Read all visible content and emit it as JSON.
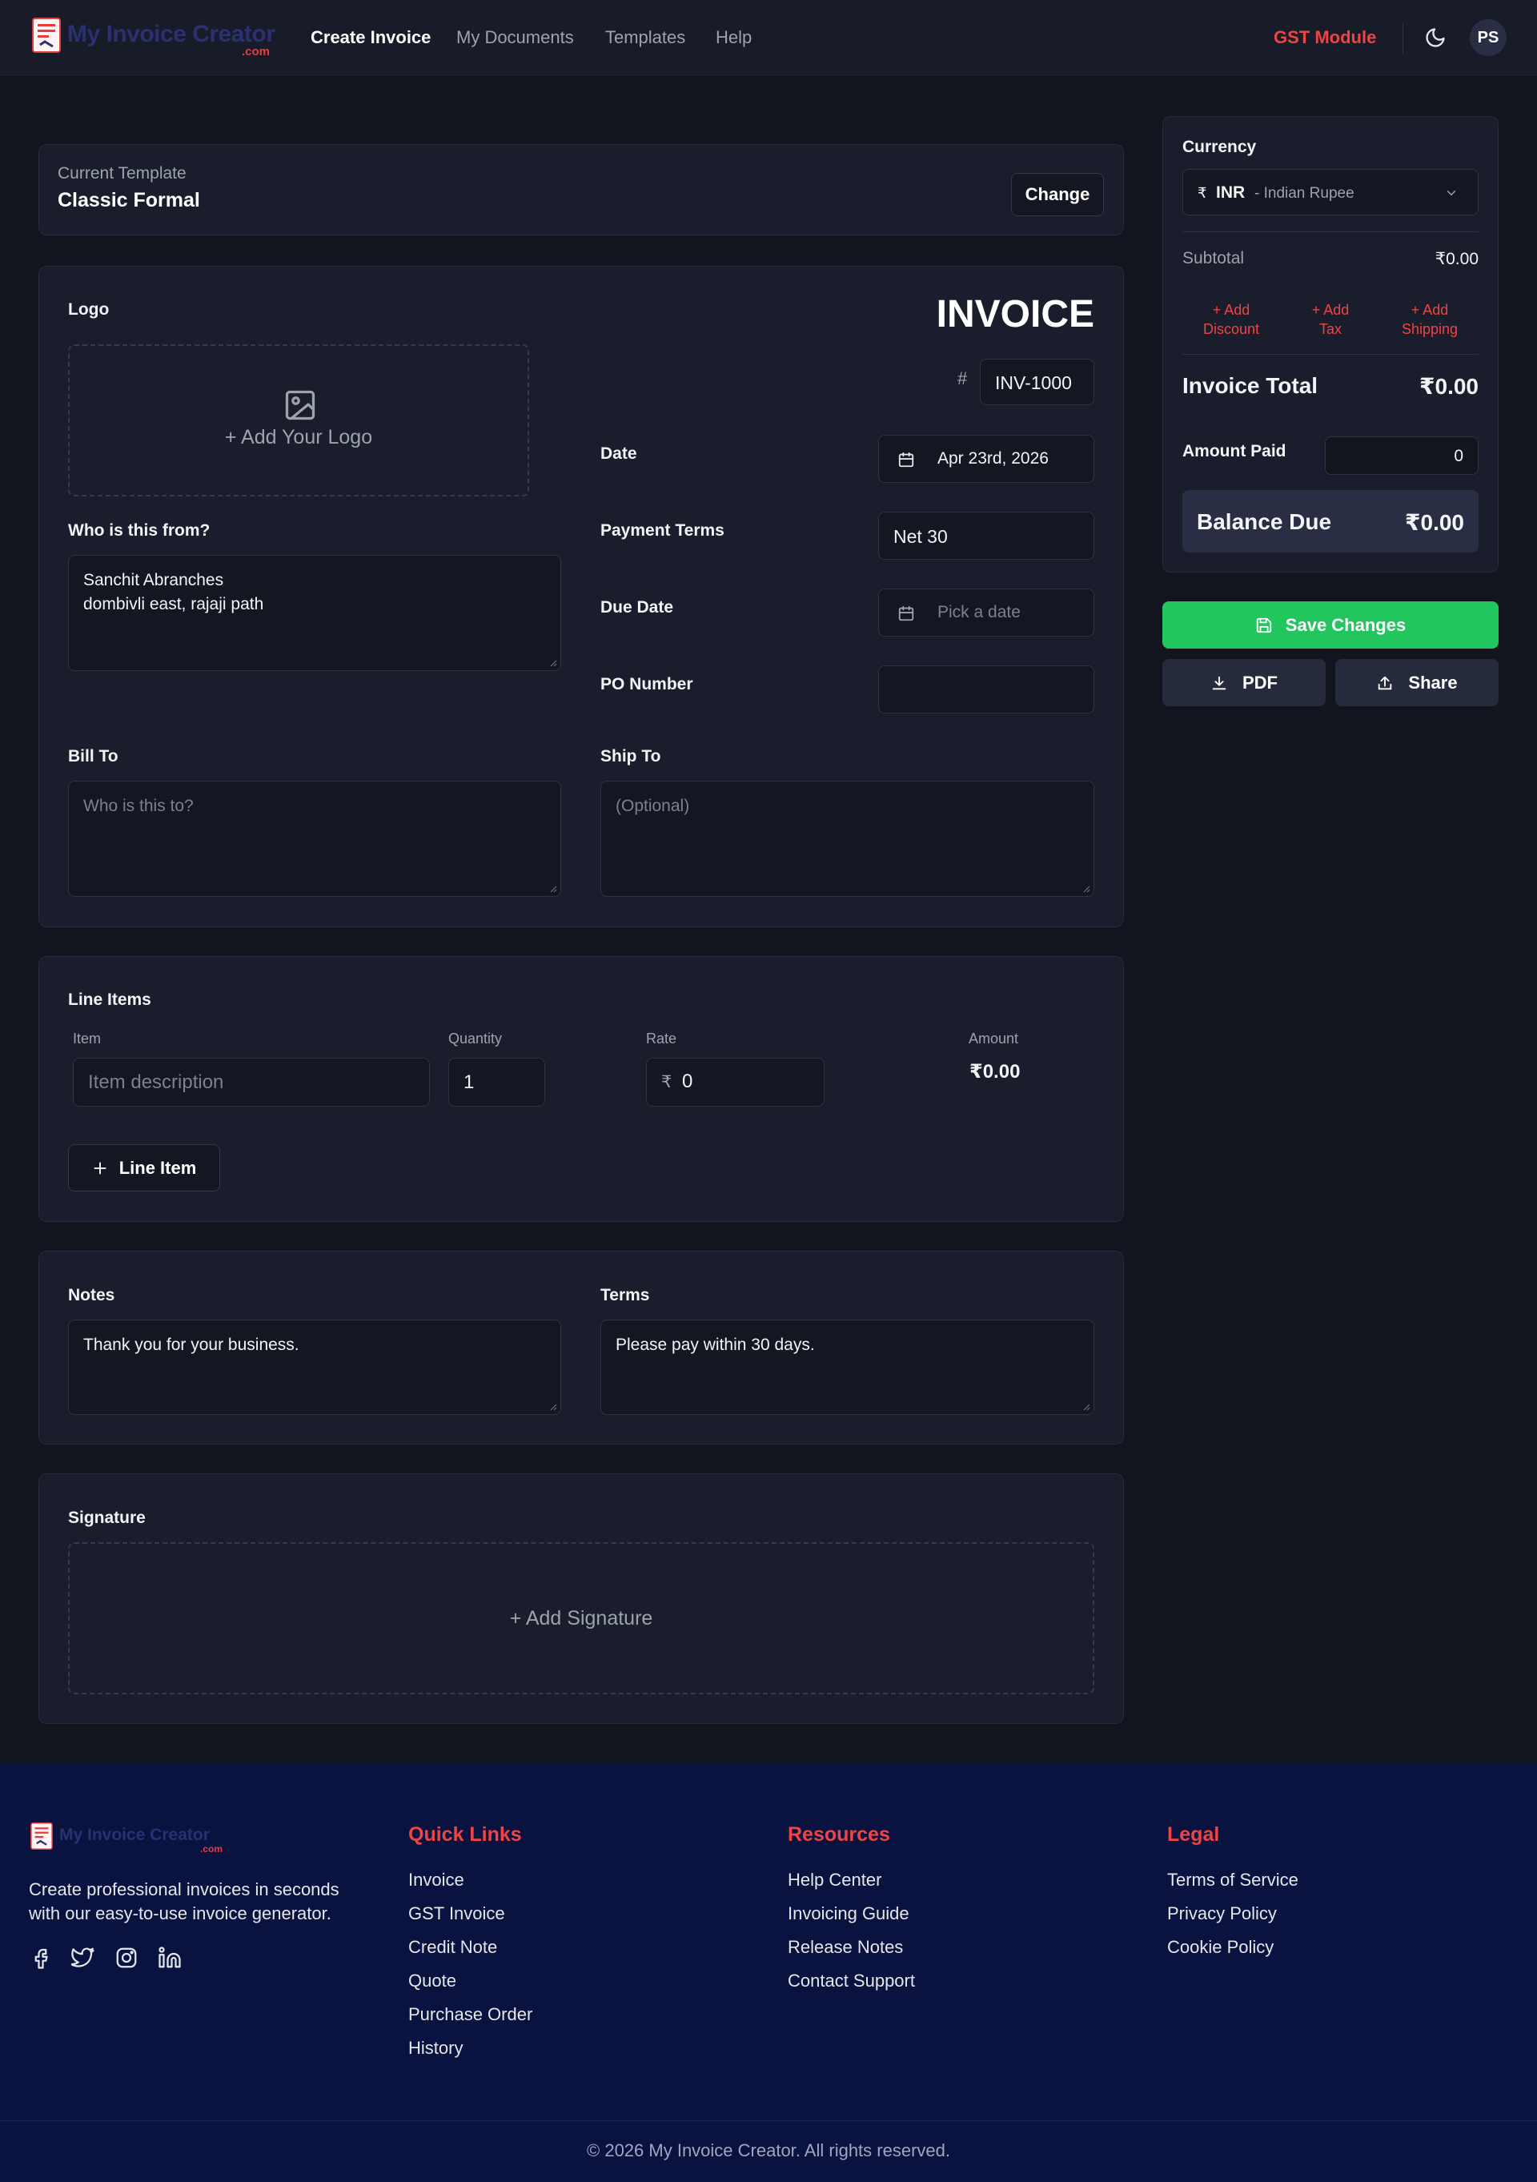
{
  "header": {
    "brand": "My Invoice Creator",
    "brand_suffix": ".com",
    "nav": [
      "Create Invoice",
      "My Documents",
      "Templates",
      "Help"
    ],
    "gst": "GST Module",
    "avatar": "PS"
  },
  "template": {
    "label": "Current Template",
    "name": "Classic Formal",
    "change": "Change"
  },
  "invoice": {
    "logo_label": "Logo",
    "logo_placeholder": "+ Add Your Logo",
    "title": "INVOICE",
    "hash": "#",
    "number": "INV-1000",
    "from_label": "Who is this from?",
    "from_value": "Sanchit Abranches\ndombivli east, rajaji path",
    "date_label": "Date",
    "date_value": "Apr 23rd, 2026",
    "terms_label": "Payment Terms",
    "terms_value": "Net 30",
    "due_label": "Due Date",
    "due_placeholder": "Pick a date",
    "po_label": "PO Number",
    "po_value": "",
    "bill_label": "Bill To",
    "bill_placeholder": "Who is this to?",
    "ship_label": "Ship To",
    "ship_placeholder": "(Optional)"
  },
  "line_items": {
    "title": "Line Items",
    "columns": [
      "Item",
      "Quantity",
      "Rate",
      "Amount"
    ],
    "rows": [
      {
        "item_placeholder": "Item description",
        "quantity": "1",
        "currency": "₹",
        "rate": "0",
        "amount": "₹0.00"
      }
    ],
    "add_label": "Line Item"
  },
  "notes": {
    "notes_label": "Notes",
    "notes_value": "Thank you for your business.",
    "terms_label": "Terms",
    "terms_value": "Please pay within 30 days."
  },
  "signature": {
    "label": "Signature",
    "placeholder": "+ Add Signature"
  },
  "summary": {
    "currency_label": "Currency",
    "currency_symbol": "₹",
    "currency_code": "INR",
    "currency_name": "- Indian Rupee",
    "subtotal_label": "Subtotal",
    "subtotal_value": "₹0.00",
    "add_discount": "+ Add\nDiscount",
    "add_tax": "+ Add\nTax",
    "add_shipping": "+ Add\nShipping",
    "total_label": "Invoice Total",
    "total_value": "₹0.00",
    "paid_label": "Amount Paid",
    "paid_value": "0",
    "balance_label": "Balance Due",
    "balance_value": "₹0.00",
    "save": "Save Changes",
    "pdf": "PDF",
    "share": "Share"
  },
  "footer": {
    "brand": "My Invoice Creator",
    "brand_suffix": ".com",
    "description": "Create professional invoices in seconds with our easy-to-use invoice generator.",
    "quick_links_title": "Quick Links",
    "quick_links": [
      "Invoice",
      "GST Invoice",
      "Credit Note",
      "Quote",
      "Purchase Order",
      "History"
    ],
    "resources_title": "Resources",
    "resources": [
      "Help Center",
      "Invoicing Guide",
      "Release Notes",
      "Contact Support"
    ],
    "legal_title": "Legal",
    "legal": [
      "Terms of Service",
      "Privacy Policy",
      "Cookie Policy"
    ],
    "copyright": "© 2026 My Invoice Creator. All rights reserved."
  },
  "colors": {
    "accent_red": "#ef4444",
    "save_green": "#22c55e",
    "footer_bg": "#0a1240"
  }
}
